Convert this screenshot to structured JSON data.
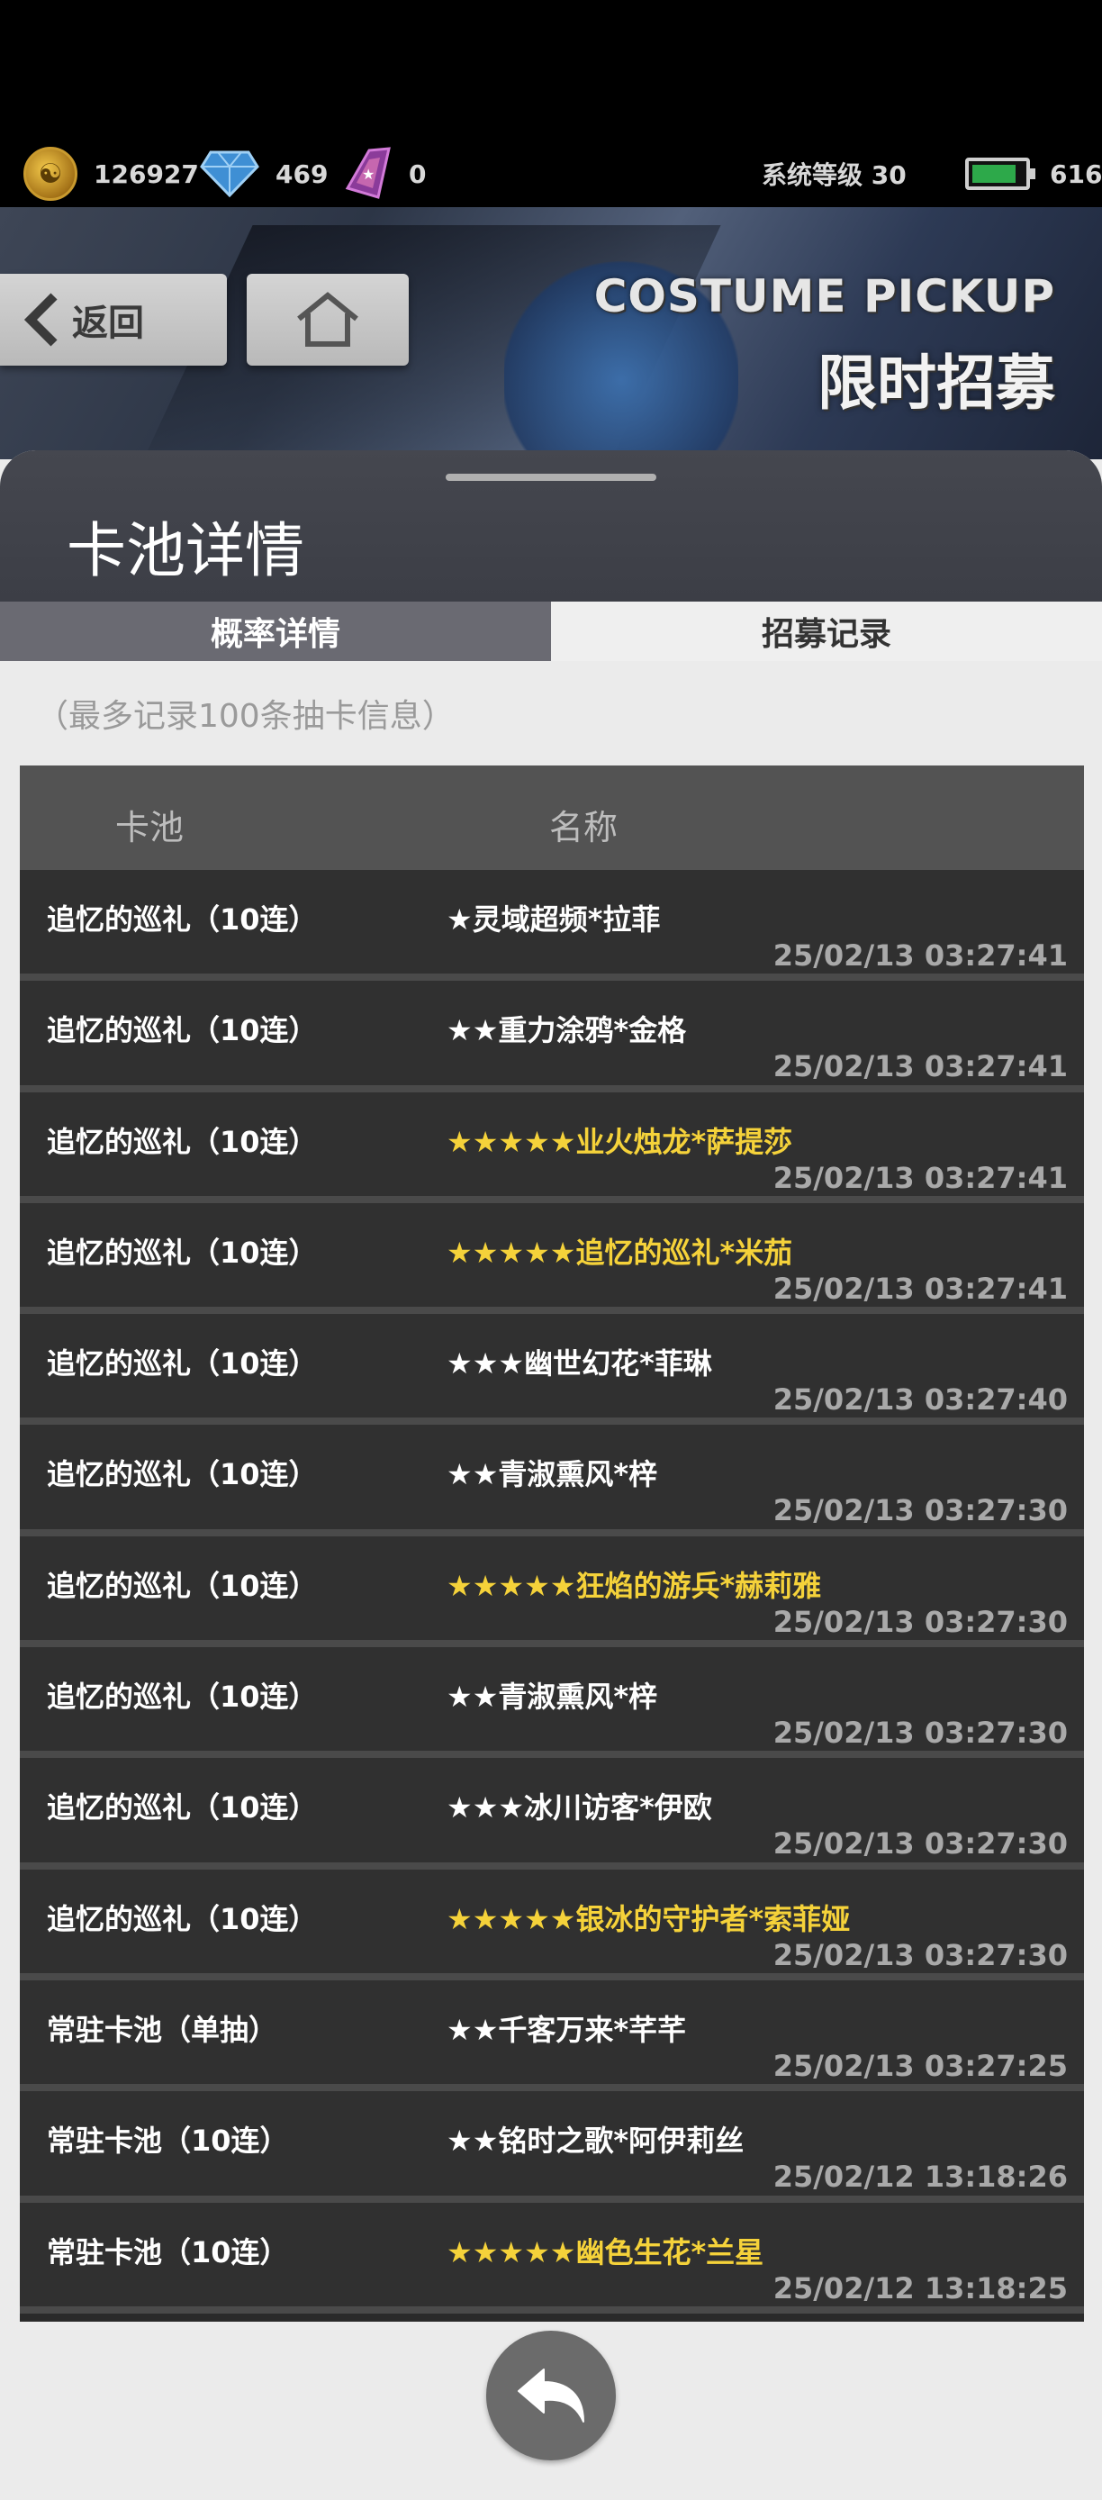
{
  "status": {
    "coins": "126927",
    "gems": "469",
    "shards": "0",
    "system_level": "系统等级 30",
    "stamina": "616",
    "icons": [
      "coin-icon",
      "diamond-icon",
      "shard-icon",
      "battery-icon"
    ]
  },
  "banner": {
    "back_label": "返回",
    "title_en": "COSTUME PICKUP",
    "title_cn": "限时招募"
  },
  "panel": {
    "title": "卡池详情",
    "tabs": [
      {
        "label": "概率详情",
        "active": false
      },
      {
        "label": "招募记录",
        "active": true
      }
    ],
    "note": "（最多记录100条抽卡信息）"
  },
  "table": {
    "headers": {
      "pool": "卡池",
      "name": "名称"
    },
    "rows": [
      {
        "pool": "追忆的巡礼（10连）",
        "name": "★灵域超频*拉菲",
        "time": "25/02/13 03:27:41",
        "rarity": 1
      },
      {
        "pool": "追忆的巡礼（10连）",
        "name": "★★重力涂鸦*金格",
        "time": "25/02/13 03:27:41",
        "rarity": 2
      },
      {
        "pool": "追忆的巡礼（10连）",
        "name": "★★★★★业火烛龙*萨提莎",
        "time": "25/02/13 03:27:41",
        "rarity": 5
      },
      {
        "pool": "追忆的巡礼（10连）",
        "name": "★★★★★追忆的巡礼*米茄",
        "time": "25/02/13 03:27:41",
        "rarity": 5
      },
      {
        "pool": "追忆的巡礼（10连）",
        "name": "★★★幽世幻花*菲琳",
        "time": "25/02/13 03:27:40",
        "rarity": 3
      },
      {
        "pool": "追忆的巡礼（10连）",
        "name": "★★青淑熏风*梓",
        "time": "25/02/13 03:27:30",
        "rarity": 2
      },
      {
        "pool": "追忆的巡礼（10连）",
        "name": "★★★★★狂焰的游兵*赫莉雅",
        "time": "25/02/13 03:27:30",
        "rarity": 5
      },
      {
        "pool": "追忆的巡礼（10连）",
        "name": "★★青淑熏风*梓",
        "time": "25/02/13 03:27:30",
        "rarity": 2
      },
      {
        "pool": "追忆的巡礼（10连）",
        "name": "★★★冰川访客*伊欧",
        "time": "25/02/13 03:27:30",
        "rarity": 3
      },
      {
        "pool": "追忆的巡礼（10连）",
        "name": "★★★★★银冰的守护者*索菲娅",
        "time": "25/02/13 03:27:30",
        "rarity": 5
      },
      {
        "pool": "常驻卡池（单抽）",
        "name": "★★千客万来*芊芊",
        "time": "25/02/13 03:27:25",
        "rarity": 2
      },
      {
        "pool": "常驻卡池（10连）",
        "name": "★★铭时之歌*阿伊莉丝",
        "time": "25/02/12 13:18:26",
        "rarity": 2
      },
      {
        "pool": "常驻卡池（10连）",
        "name": "★★★★★幽色生花*兰星",
        "time": "25/02/12 13:18:25",
        "rarity": 5
      }
    ]
  },
  "colors": {
    "five_star": "#f5d23a",
    "row_bg": "#303030",
    "header_bg": "#535353",
    "tab_inactive": "#6a6a72"
  }
}
